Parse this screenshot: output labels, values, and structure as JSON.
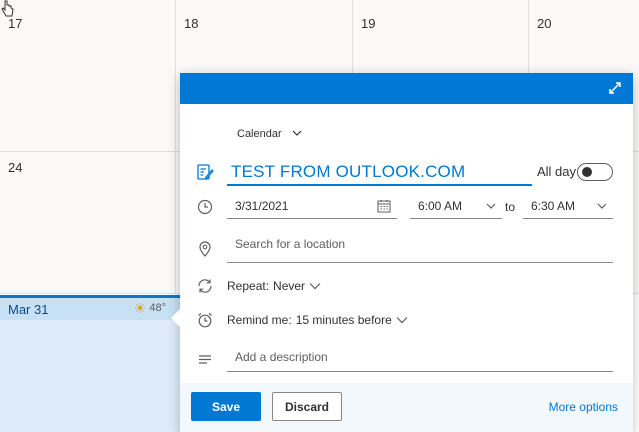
{
  "calendar": {
    "days_row1": [
      "17",
      "18",
      "19",
      "20"
    ],
    "days_row2": [
      "24"
    ],
    "today": {
      "label": "Mar 31",
      "temperature": "48°"
    }
  },
  "event_form": {
    "calendar_select": "Calendar",
    "title_value": "TEST FROM OUTLOOK.COM",
    "all_day_label": "All day",
    "all_day_on": false,
    "date_value": "3/31/2021",
    "start_time": "6:00 AM",
    "to_label": "to",
    "end_time": "6:30 AM",
    "location_placeholder": "Search for a location",
    "repeat_label": "Repeat:",
    "repeat_value": "Never",
    "remind_label": "Remind me:",
    "remind_value": "15 minutes before",
    "description_placeholder": "Add a description"
  },
  "footer": {
    "save_label": "Save",
    "discard_label": "Discard",
    "more_options_label": "More options"
  },
  "colors": {
    "accent": "#0078d4",
    "today_bg": "#deecf9",
    "footer_bg": "#f3f8fd"
  },
  "icons": {
    "expand": "expand-icon",
    "calendar_dropdown": "chevron-down-icon",
    "title": "edit-note-icon",
    "time": "clock-icon",
    "date_picker": "calendar-icon",
    "location": "location-pin-icon",
    "repeat": "repeat-icon",
    "reminder": "alarm-clock-icon",
    "description": "text-lines-icon",
    "weather": "sun-icon"
  }
}
